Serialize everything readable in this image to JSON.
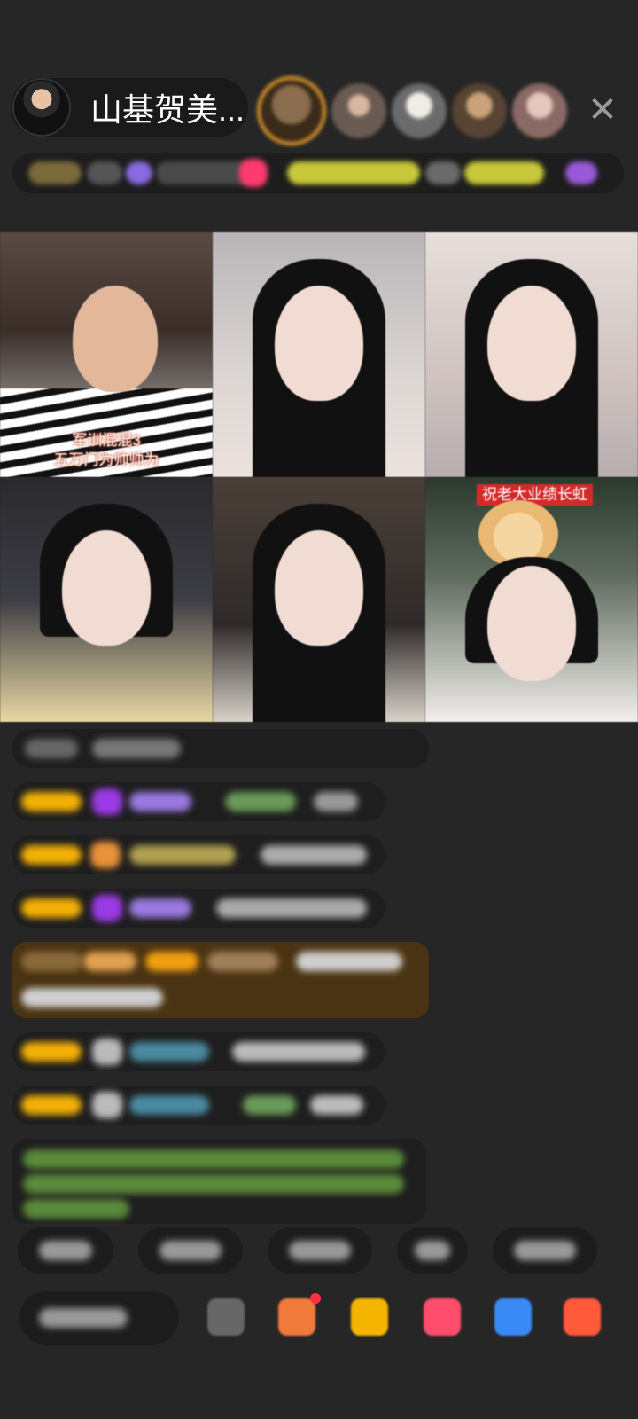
{
  "host": {
    "name": "山基贺美..."
  },
  "header": {
    "close_glyph": "✕"
  },
  "video_cells": [
    {
      "caption_line1": "军训混混3",
      "caption_line2": "五万门为帅帅为"
    },
    {},
    {},
    {},
    {},
    {
      "banner": "祝老大业绩长虹"
    }
  ],
  "colors": {
    "accent_badge": "#f2b007",
    "diamond": "#9b3be6",
    "gold_message_bg": "#4a3312",
    "viewer_ring": "#e09a2b"
  }
}
